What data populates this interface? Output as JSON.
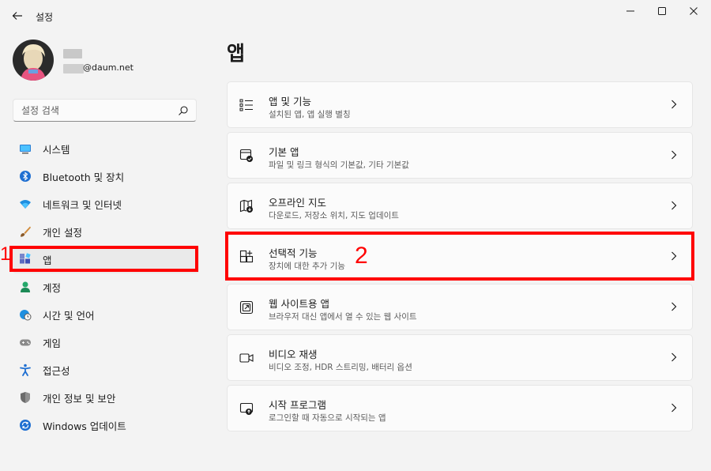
{
  "window": {
    "title": "설정"
  },
  "profile": {
    "email_suffix": "@daum.net"
  },
  "search": {
    "placeholder": "설정 검색"
  },
  "sidebar": {
    "items": [
      {
        "label": "시스템",
        "icon": "monitor-icon"
      },
      {
        "label": "Bluetooth 및 장치",
        "icon": "bluetooth-icon"
      },
      {
        "label": "네트워크 및 인터넷",
        "icon": "wifi-icon"
      },
      {
        "label": "개인 설정",
        "icon": "brush-icon"
      },
      {
        "label": "앱",
        "icon": "apps-icon"
      },
      {
        "label": "계정",
        "icon": "person-icon"
      },
      {
        "label": "시간 및 언어",
        "icon": "globe-clock-icon"
      },
      {
        "label": "게임",
        "icon": "gamepad-icon"
      },
      {
        "label": "접근성",
        "icon": "accessibility-icon"
      },
      {
        "label": "개인 정보 및 보안",
        "icon": "shield-icon"
      },
      {
        "label": "Windows 업데이트",
        "icon": "update-icon"
      }
    ],
    "active_index": 4
  },
  "main": {
    "title": "앱",
    "cards": [
      {
        "title": "앱 및 기능",
        "subtitle": "설치된 앱, 앱 실행 별칭",
        "icon": "list-icon"
      },
      {
        "title": "기본 앱",
        "subtitle": "파일 및 링크 형식의 기본값, 기타 기본값",
        "icon": "default-apps-icon"
      },
      {
        "title": "오프라인 지도",
        "subtitle": "다운로드, 저장소 위치, 지도 업데이트",
        "icon": "map-icon"
      },
      {
        "title": "선택적 기능",
        "subtitle": "장치에 대한 추가 기능",
        "icon": "add-feature-icon"
      },
      {
        "title": "웹 사이트용 앱",
        "subtitle": "브라우저 대신 앱에서 열 수 있는 웹 사이트",
        "icon": "web-app-icon"
      },
      {
        "title": "비디오 재생",
        "subtitle": "비디오 조정, HDR 스트리밍, 배터리 옵션",
        "icon": "video-icon"
      },
      {
        "title": "시작 프로그램",
        "subtitle": "로그인할 때 자동으로 시작되는 앱",
        "icon": "startup-icon"
      }
    ]
  },
  "annotations": {
    "marker_1": "1",
    "marker_2": "2",
    "color": "#ff0000"
  }
}
